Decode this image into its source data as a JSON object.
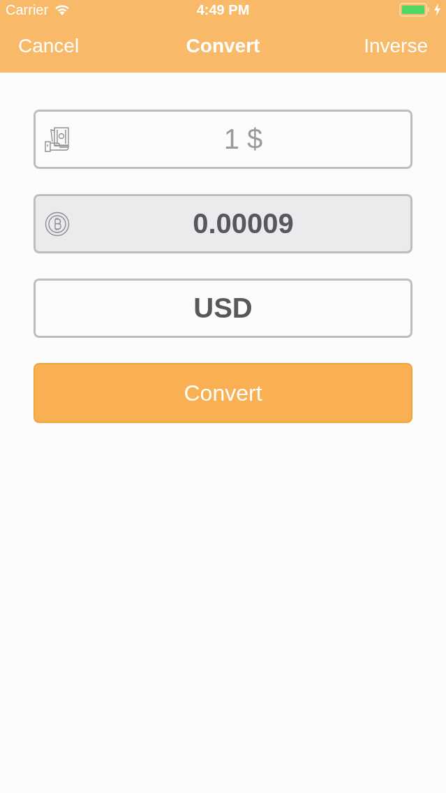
{
  "status_bar": {
    "carrier": "Carrier",
    "time": "4:49 PM"
  },
  "nav_bar": {
    "left": "Cancel",
    "title": "Convert",
    "right": "Inverse"
  },
  "fields": [
    {
      "kind": "cash",
      "placeholder": "1 $",
      "disabled": false
    },
    {
      "kind": "coin",
      "value": "0.00009",
      "disabled": true
    },
    {
      "kind": "plain",
      "value": "USD",
      "disabled": false
    }
  ],
  "button": {
    "label": "Convert"
  }
}
